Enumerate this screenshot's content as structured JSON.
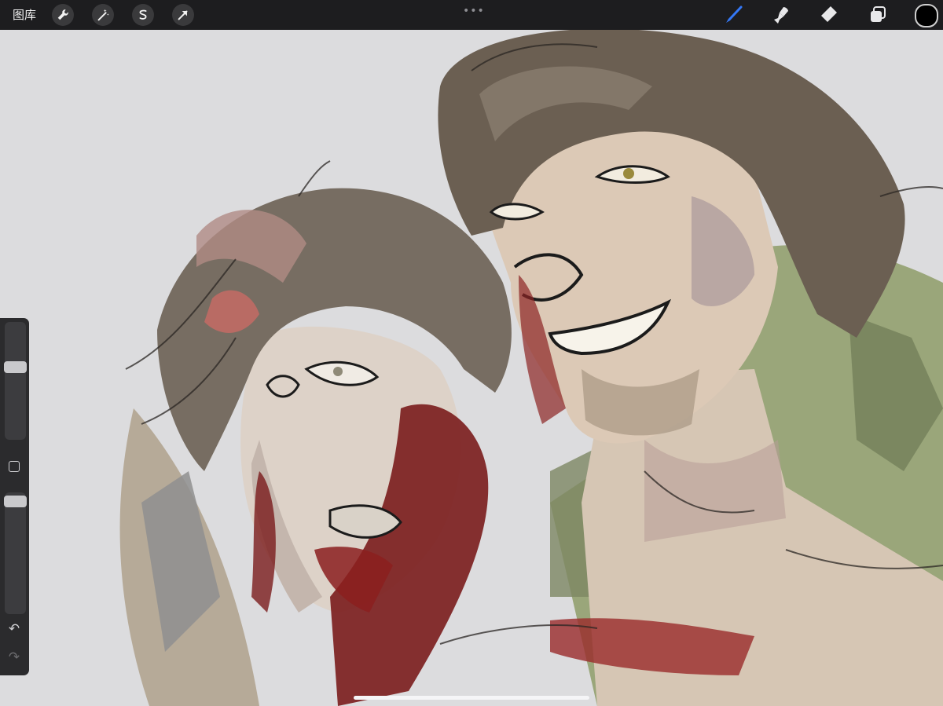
{
  "topbar": {
    "gallery_label": "图库",
    "left_tools": [
      "wrench-icon",
      "magic-wand-icon",
      "selection-s-icon",
      "transform-arrow-icon"
    ],
    "more_label": "•••",
    "right_tools": [
      "brush-icon",
      "smudge-icon",
      "eraser-icon",
      "layers-icon"
    ],
    "active_tool": "brush-icon",
    "accent_color": "#3478f6",
    "current_color": "#000000"
  },
  "sidebar": {
    "brush_size_level": 0.86,
    "brush_opacity_level": 0.94,
    "modify_button": "square-icon",
    "undo_label": "↶",
    "redo_label": "↷"
  },
  "canvas": {
    "background_color": "#dcdcde"
  }
}
